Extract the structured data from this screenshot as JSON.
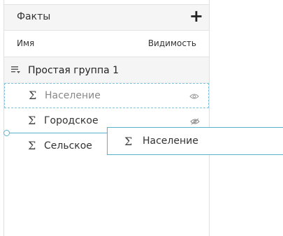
{
  "panel": {
    "title": "Факты",
    "add_label": "+",
    "columns": {
      "name": "Имя",
      "visibility": "Видимость"
    }
  },
  "group": {
    "label": "Простая группа 1",
    "icon": "group-sort-icon"
  },
  "items": [
    {
      "symbol": "Σ",
      "label": "Население",
      "visibility": "visible",
      "icon": "eye-icon"
    },
    {
      "symbol": "Σ",
      "label": "Городское",
      "visibility": "hidden",
      "icon": "eye-off-icon"
    },
    {
      "symbol": "Σ",
      "label": "Сельское"
    }
  ],
  "drag_ghost": {
    "symbol": "Σ",
    "label": "Население"
  },
  "colors": {
    "accent": "#5bb1cc",
    "header_bg": "#f5f5f5",
    "selection_border": "#7fc4dc"
  }
}
